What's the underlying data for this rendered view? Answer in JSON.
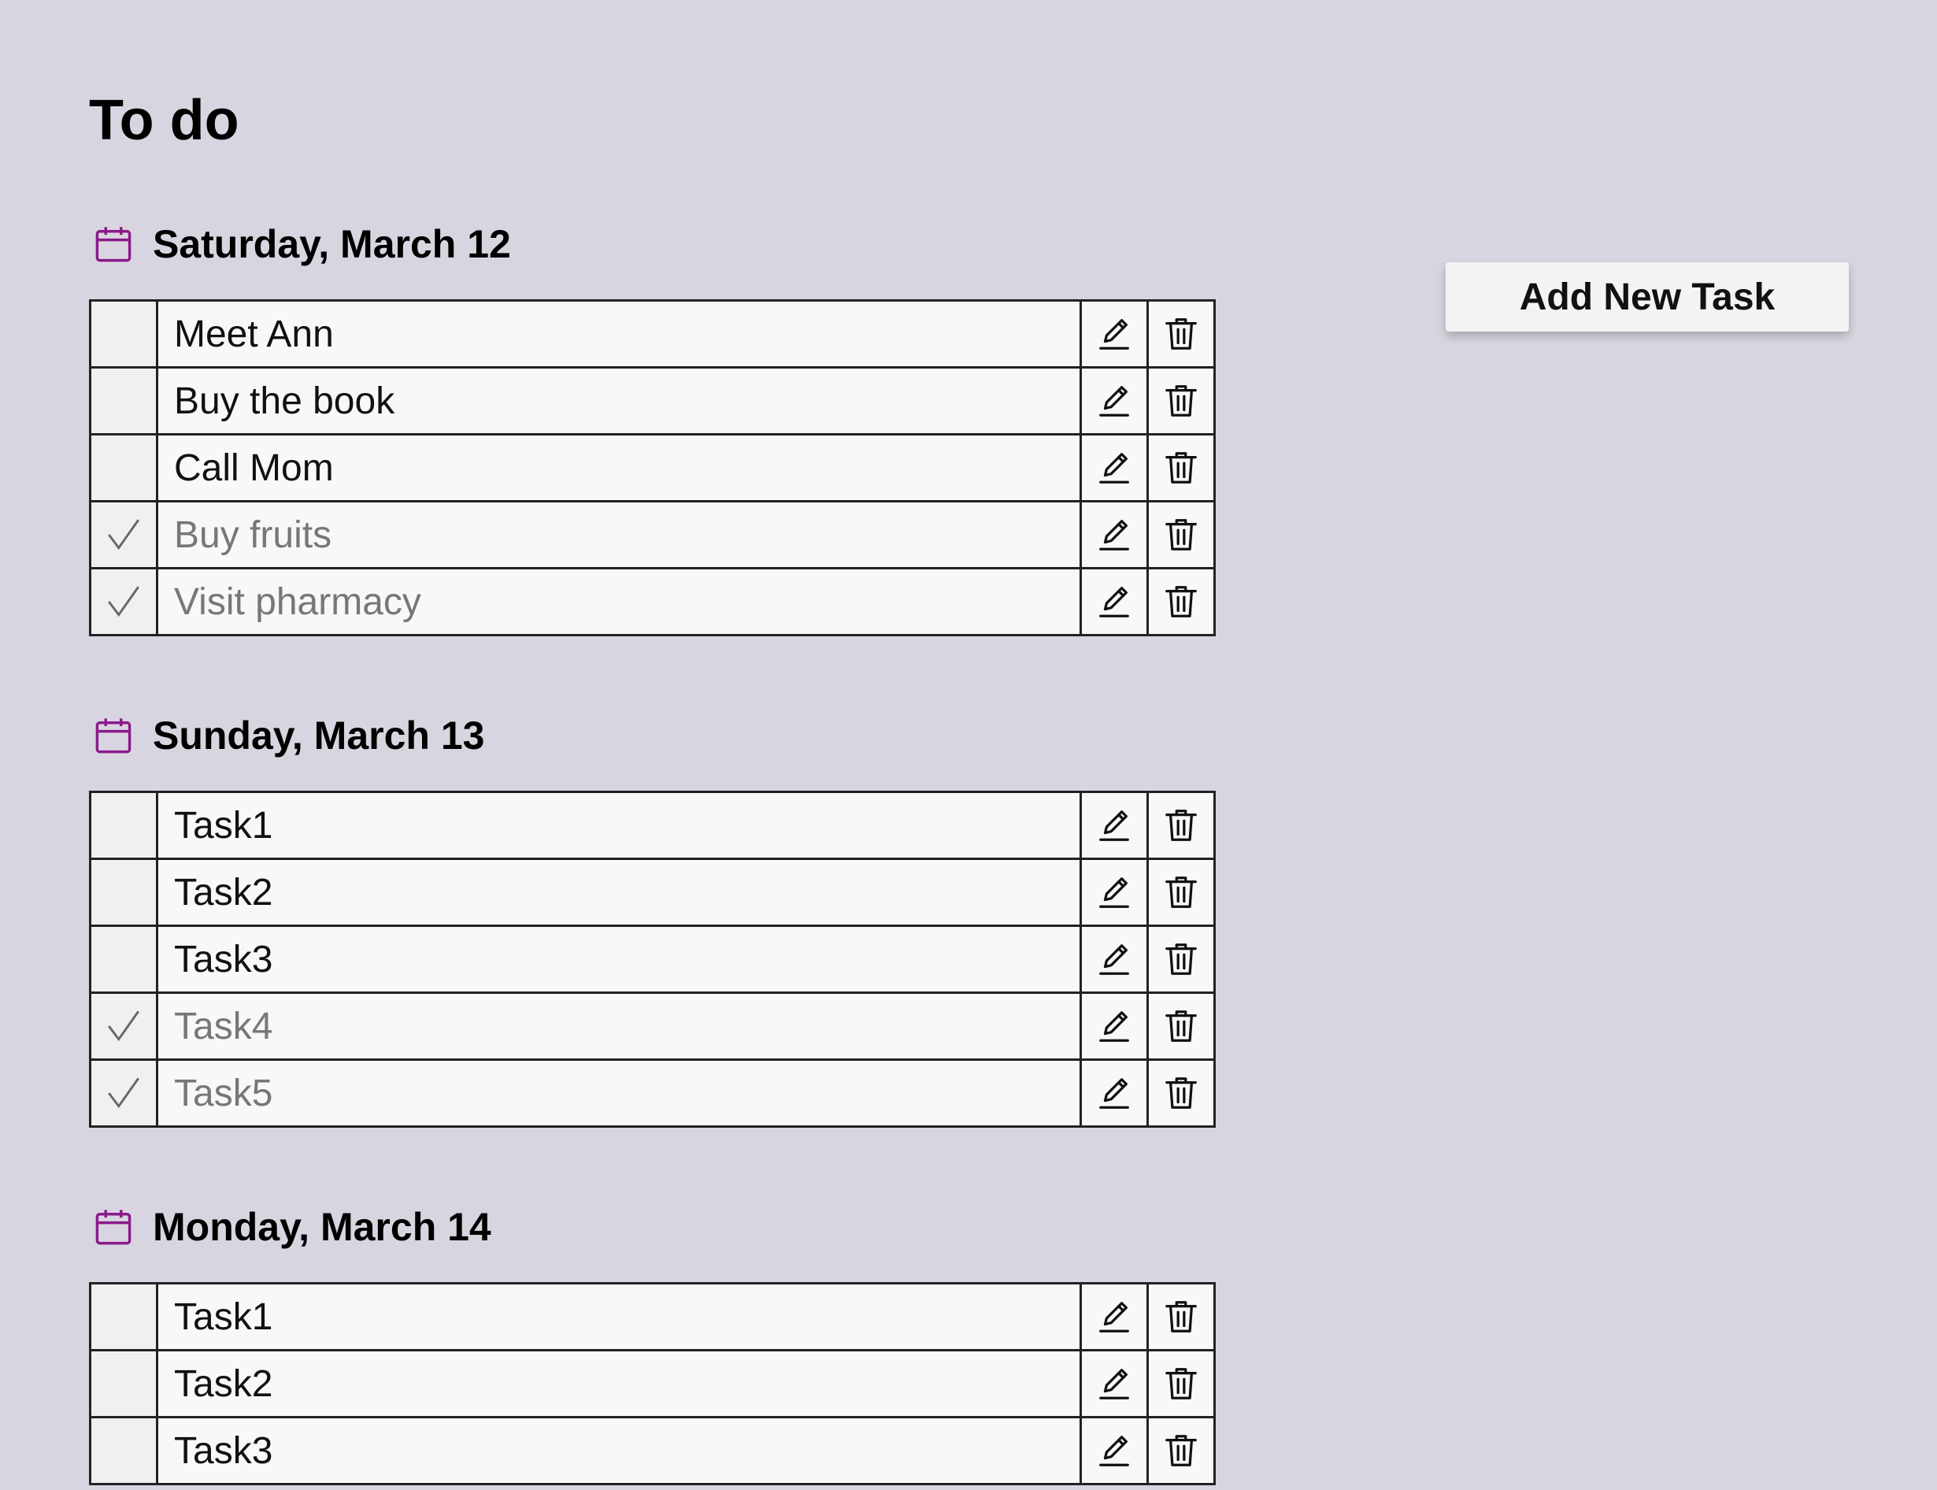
{
  "page": {
    "title": "To do"
  },
  "add_button": {
    "label": "Add New Task"
  },
  "colors": {
    "background": "#d9d5e0",
    "calendar_icon": "#8a1a8a",
    "done_text": "#777777"
  },
  "icons": {
    "calendar": "calendar-icon",
    "edit": "pencil-icon",
    "delete": "trash-icon",
    "done": "check-icon"
  },
  "days": [
    {
      "title": "Saturday, March 12",
      "tasks": [
        {
          "text": "Meet Ann",
          "done": false
        },
        {
          "text": "Buy the book",
          "done": false
        },
        {
          "text": "Call Mom",
          "done": false
        },
        {
          "text": "Buy fruits",
          "done": true
        },
        {
          "text": "Visit pharmacy",
          "done": true
        }
      ]
    },
    {
      "title": "Sunday, March 13",
      "tasks": [
        {
          "text": "Task1",
          "done": false
        },
        {
          "text": "Task2",
          "done": false
        },
        {
          "text": "Task3",
          "done": false
        },
        {
          "text": "Task4",
          "done": true
        },
        {
          "text": "Task5",
          "done": true
        }
      ]
    },
    {
      "title": "Monday, March 14",
      "tasks": [
        {
          "text": "Task1",
          "done": false
        },
        {
          "text": "Task2",
          "done": false
        },
        {
          "text": "Task3",
          "done": false
        }
      ]
    }
  ]
}
